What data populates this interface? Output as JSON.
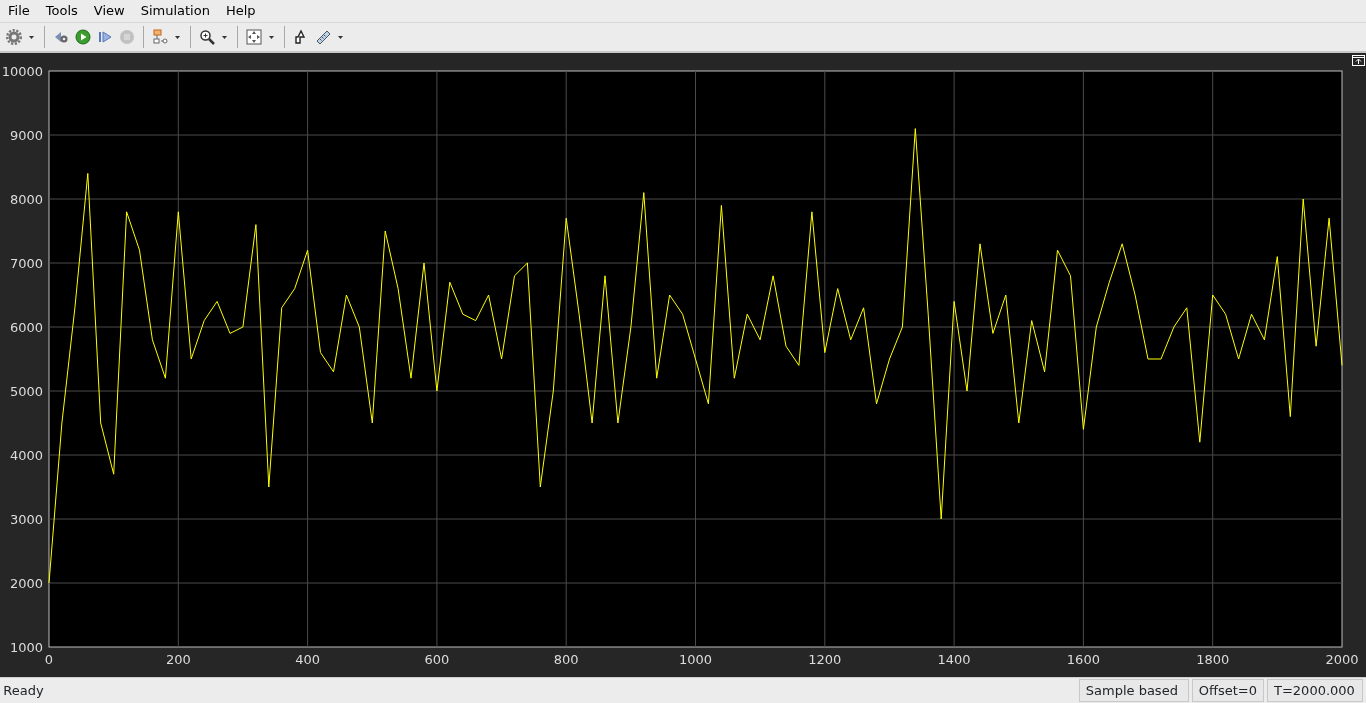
{
  "menu": [
    {
      "label": "File"
    },
    {
      "label": "Tools"
    },
    {
      "label": "View"
    },
    {
      "label": "Simulation"
    },
    {
      "label": "Help"
    }
  ],
  "toolbar": [
    {
      "kind": "settings",
      "has_menu": true,
      "disabled": false
    },
    {
      "kind": "separator"
    },
    {
      "kind": "step-back",
      "has_menu": false,
      "disabled": false
    },
    {
      "kind": "run",
      "has_menu": false,
      "disabled": false
    },
    {
      "kind": "step-forward",
      "has_menu": false,
      "disabled": false
    },
    {
      "kind": "stop",
      "has_menu": false,
      "disabled": true
    },
    {
      "kind": "separator"
    },
    {
      "kind": "highlight",
      "has_menu": true,
      "disabled": false
    },
    {
      "kind": "separator"
    },
    {
      "kind": "zoom",
      "has_menu": true,
      "disabled": false
    },
    {
      "kind": "separator"
    },
    {
      "kind": "fit",
      "has_menu": true,
      "disabled": false
    },
    {
      "kind": "separator"
    },
    {
      "kind": "style",
      "has_menu": false,
      "disabled": false
    },
    {
      "kind": "measure",
      "has_menu": true,
      "disabled": false
    }
  ],
  "scope": {
    "chart_data": {
      "type": "line",
      "grid": true,
      "xlim": [
        0,
        2000
      ],
      "ylim": [
        1000,
        10000
      ],
      "xticks": [
        0,
        200,
        400,
        600,
        800,
        1000,
        1200,
        1400,
        1600,
        1800,
        2000
      ],
      "yticks": [
        1000,
        2000,
        3000,
        4000,
        5000,
        6000,
        7000,
        8000,
        9000,
        10000
      ],
      "x": [
        0,
        20,
        40,
        60,
        80,
        100,
        120,
        140,
        160,
        180,
        200,
        220,
        240,
        260,
        280,
        300,
        320,
        340,
        360,
        380,
        400,
        420,
        440,
        460,
        480,
        500,
        520,
        540,
        560,
        580,
        600,
        620,
        640,
        660,
        680,
        700,
        720,
        740,
        760,
        780,
        800,
        820,
        840,
        860,
        880,
        900,
        920,
        940,
        960,
        980,
        1000,
        1020,
        1040,
        1060,
        1080,
        1100,
        1120,
        1140,
        1160,
        1180,
        1200,
        1220,
        1240,
        1260,
        1280,
        1300,
        1320,
        1340,
        1360,
        1380,
        1400,
        1420,
        1440,
        1460,
        1480,
        1500,
        1520,
        1540,
        1560,
        1580,
        1600,
        1620,
        1640,
        1660,
        1680,
        1700,
        1720,
        1740,
        1760,
        1780,
        1800,
        1820,
        1840,
        1860,
        1880,
        1900,
        1920,
        1940,
        1960,
        1980,
        2000
      ],
      "series": [
        {
          "color": "#ffff00",
          "values": [
            2000,
            4500,
            6300,
            8400,
            4500,
            3700,
            7800,
            7200,
            5800,
            5200,
            7800,
            5500,
            6100,
            6400,
            5900,
            6000,
            7600,
            3500,
            6300,
            6600,
            7200,
            5600,
            5300,
            6500,
            6000,
            4500,
            7500,
            6600,
            5200,
            7000,
            5000,
            6700,
            6200,
            6100,
            6500,
            5500,
            6800,
            7000,
            3500,
            5000,
            7700,
            6200,
            4500,
            6800,
            4500,
            6000,
            8100,
            5200,
            6500,
            6200,
            5500,
            4800,
            7900,
            5200,
            6200,
            5800,
            6800,
            5700,
            5400,
            7800,
            5600,
            6600,
            5800,
            6300,
            4800,
            5500,
            6000,
            9100,
            6200,
            3000,
            6400,
            5000,
            7300,
            5900,
            6500,
            4500,
            6100,
            5300,
            7200,
            6800,
            4400,
            6000,
            6700,
            7300,
            6500,
            5500,
            5500,
            6000,
            6300,
            4200,
            6500,
            6200,
            5500,
            6200,
            5800,
            7100,
            4600,
            8000,
            5700,
            7700,
            5400
          ]
        }
      ]
    }
  },
  "status_bar": {
    "message": "Ready",
    "fields": [
      "Sample based",
      "Offset=0",
      "T=2000.000"
    ]
  }
}
